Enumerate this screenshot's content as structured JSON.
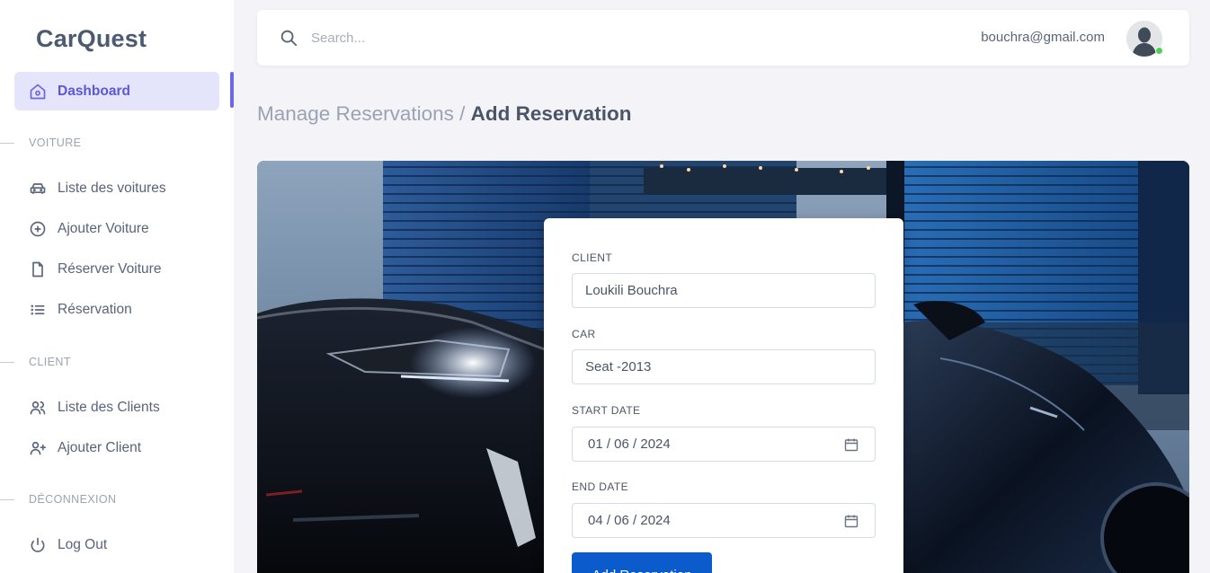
{
  "brand": "CarQuest",
  "sidebar": {
    "active": {
      "label": "Dashboard",
      "icon": "home-icon"
    },
    "sections": [
      {
        "title": "VOITURE",
        "items": [
          {
            "label": "Liste des voitures",
            "icon": "car-icon"
          },
          {
            "label": "Ajouter Voiture",
            "icon": "plus-circle-icon"
          },
          {
            "label": "Réserver Voiture",
            "icon": "file-icon"
          },
          {
            "label": "Réservation",
            "icon": "list-icon"
          }
        ]
      },
      {
        "title": "CLIENT",
        "items": [
          {
            "label": "Liste des Clients",
            "icon": "users-icon"
          },
          {
            "label": "Ajouter Client",
            "icon": "user-plus-icon"
          }
        ]
      },
      {
        "title": "DÉCONNEXION",
        "items": [
          {
            "label": "Log Out",
            "icon": "power-icon"
          }
        ]
      }
    ]
  },
  "topbar": {
    "search_placeholder": "Search...",
    "email": "bouchra@gmail.com"
  },
  "breadcrumb": {
    "parent": "Manage Reservations",
    "separator": " / ",
    "current": "Add Reservation"
  },
  "form": {
    "client_label": "CLIENT",
    "client_value": "Loukili Bouchra",
    "car_label": "CAR",
    "car_value": "Seat -2013",
    "start_label": "START DATE",
    "start_value": "01 / 06 / 2024",
    "end_label": "END DATE",
    "end_value": "04 / 06 / 2024",
    "submit_label": "Add Reservation"
  },
  "colors": {
    "accent": "#6c63e6",
    "active_bg": "#e4e4fb",
    "primary_button": "#0b5bcc",
    "online": "#4cd05a"
  }
}
